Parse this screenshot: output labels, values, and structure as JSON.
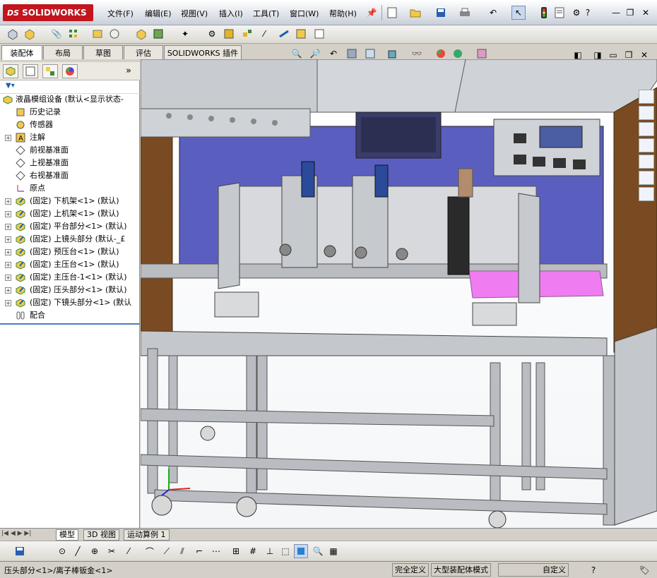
{
  "app": {
    "brand": "SOLIDWORKS",
    "brand_prefix": "DS"
  },
  "menu": [
    "文件(F)",
    "编辑(E)",
    "视图(V)",
    "插入(I)",
    "工具(T)",
    "窗口(W)",
    "帮助(H)"
  ],
  "window_controls": {
    "minimize": "—",
    "restore": "❐",
    "close": "✕"
  },
  "command_tabs": [
    "装配体",
    "布局",
    "草图",
    "评估",
    "SOLIDWORKS 插件"
  ],
  "active_command_tab": "装配体",
  "tree": {
    "root": "液晶模组设备  (默认<显示状态-",
    "items": [
      {
        "label": "历史记录",
        "icon": "history-icon",
        "expand": false
      },
      {
        "label": "传感器",
        "icon": "sensor-icon",
        "expand": false
      },
      {
        "label": "注解",
        "icon": "annotation-icon",
        "expand": true
      },
      {
        "label": "前视基准面",
        "icon": "plane-icon",
        "expand": false
      },
      {
        "label": "上视基准面",
        "icon": "plane-icon",
        "expand": false
      },
      {
        "label": "右视基准面",
        "icon": "plane-icon",
        "expand": false
      },
      {
        "label": "原点",
        "icon": "origin-icon",
        "expand": false
      },
      {
        "label": "(固定) 下机架<1> (默认)",
        "icon": "component-icon",
        "expand": true
      },
      {
        "label": "(固定) 上机架<1> (默认)",
        "icon": "component-icon",
        "expand": true
      },
      {
        "label": "(固定) 平台部分<1> (默认)",
        "icon": "component-icon",
        "expand": true
      },
      {
        "label": "(固定) 上镜头部分 (默认-_£",
        "icon": "component-icon",
        "expand": true
      },
      {
        "label": "(固定) 预压台<1> (默认)",
        "icon": "component-icon",
        "expand": true
      },
      {
        "label": "(固定) 主压台<1> (默认)",
        "icon": "component-icon",
        "expand": true
      },
      {
        "label": "(固定) 主压台-1<1> (默认)",
        "icon": "component-icon",
        "expand": true
      },
      {
        "label": "(固定) 压头部分<1> (默认)",
        "icon": "component-icon",
        "expand": true
      },
      {
        "label": "(固定) 下镜头部分<1> (默认",
        "icon": "component-icon",
        "expand": true
      },
      {
        "label": "配合",
        "icon": "mates-icon",
        "expand": false
      }
    ]
  },
  "bottom_tabs": [
    "模型",
    "3D 视图",
    "运动算例 1"
  ],
  "active_bottom_tab": "模型",
  "status": {
    "selection": "压头部分<1>/离子棒钣金<1>",
    "definition": "完全定义",
    "mode": "大型装配体模式",
    "units": "自定义"
  },
  "colors": {
    "accent": "#c2151d",
    "viewport_panel": "#5a5fbf",
    "frame": "#b9bcc0",
    "pink": "#f07cf2",
    "wood": "#7a4a22"
  }
}
